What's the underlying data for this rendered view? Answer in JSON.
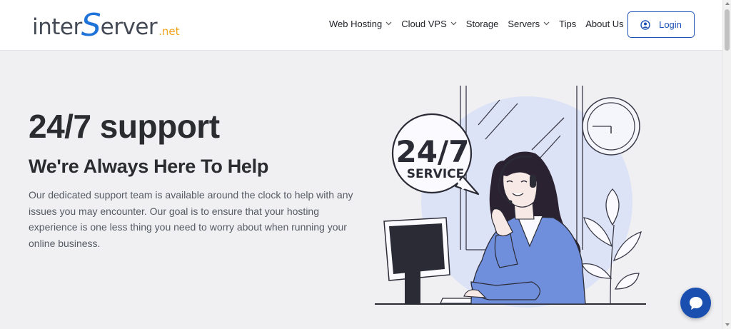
{
  "header": {
    "logo": {
      "part1": "inter",
      "part2": "S",
      "part3": "erver",
      "suffix": ".net"
    },
    "nav": [
      {
        "label": "Web Hosting",
        "dropdown": true
      },
      {
        "label": "Cloud VPS",
        "dropdown": true
      },
      {
        "label": "Storage",
        "dropdown": false
      },
      {
        "label": "Servers",
        "dropdown": true
      },
      {
        "label": "Tips",
        "dropdown": false
      },
      {
        "label": "About Us",
        "dropdown": true
      }
    ],
    "login_label": "Login"
  },
  "hero": {
    "title": "24/7 support",
    "subtitle": "We're Always Here To Help",
    "description": "Our dedicated support team is available around the clock to help with any issues you may encounter. Our goal is to ensure that your hosting experience is one less thing you need to worry about when running your online business."
  },
  "illustration": {
    "badge_line1": "24/7",
    "badge_line2": "SERVICE"
  },
  "colors": {
    "brand_blue": "#1b4fb5",
    "logo_orange": "#f2a31c",
    "logo_gray": "#444a55",
    "background": "#f0f0f3",
    "illustration_blue": "#6f8fdc",
    "illustration_bg": "#dde3f6"
  },
  "icons": {
    "login": "user-circle-icon",
    "chat": "chat-bubble-icon",
    "nav_dropdown": "chevron-down-icon"
  }
}
